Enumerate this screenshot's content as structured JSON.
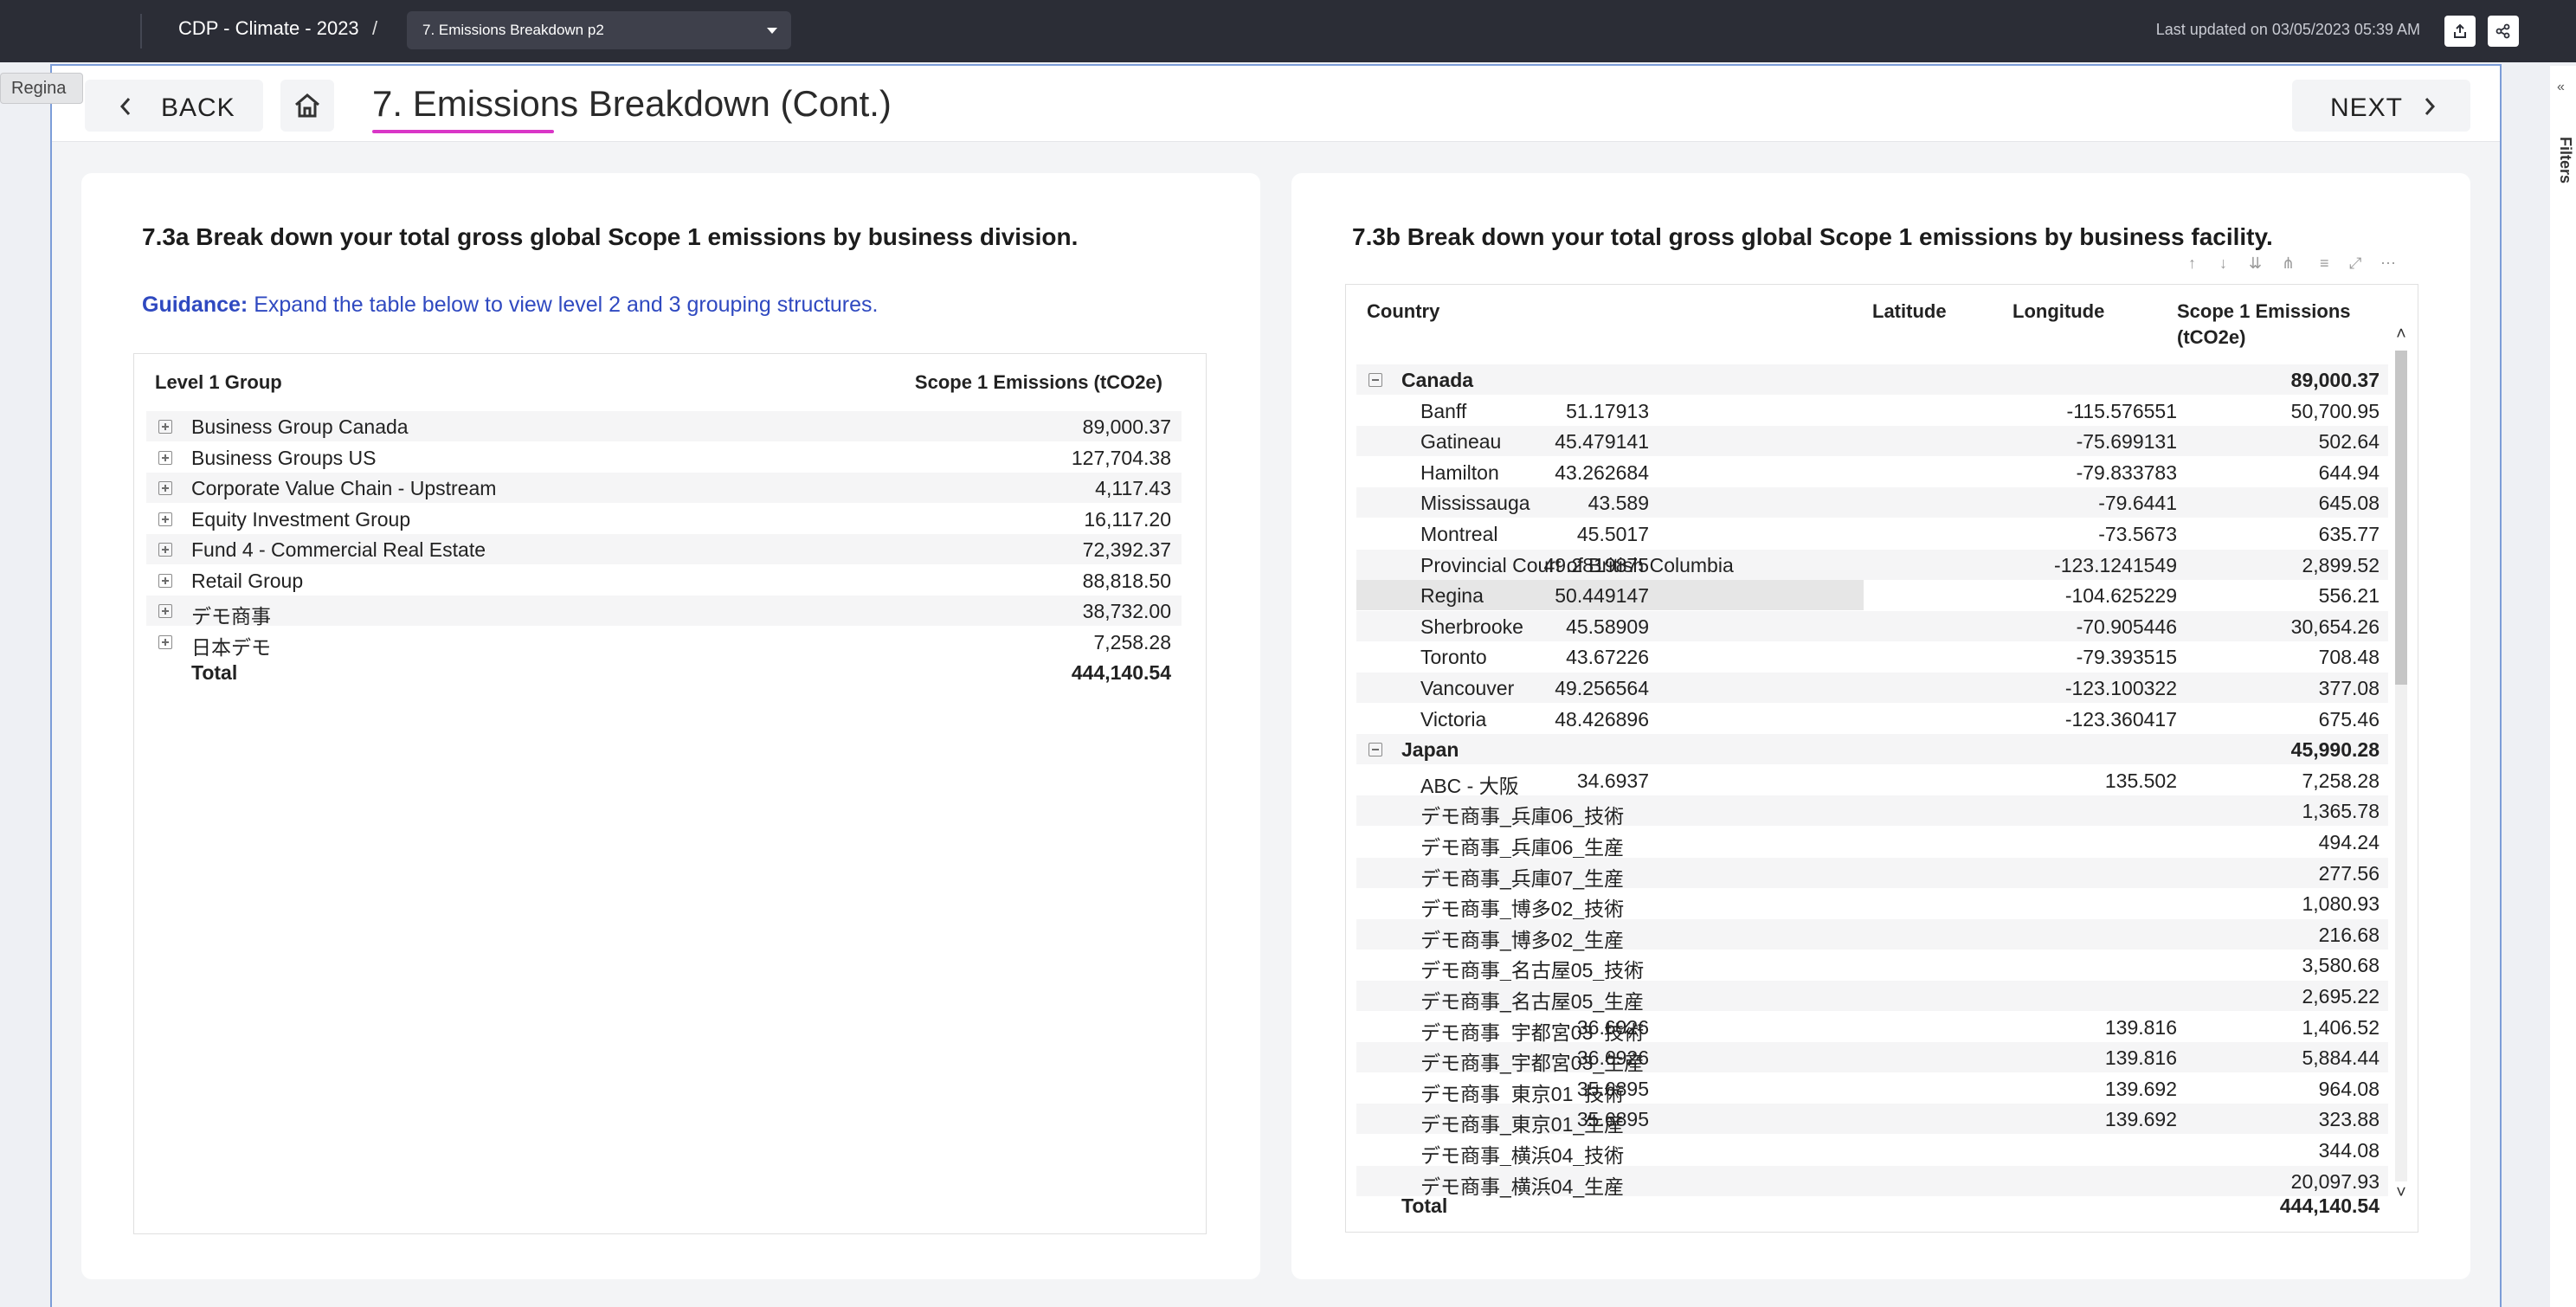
{
  "topbar": {
    "breadcrumb": "CDP - Climate - 2023",
    "slash": "/",
    "page_select": "7. Emissions Breakdown p2",
    "last_updated": "Last updated on 03/05/2023 05:39 AM"
  },
  "tooltip": "Regina",
  "nav": {
    "back_label": "BACK",
    "next_label": "NEXT",
    "title": "7. Emissions Breakdown (Cont.)"
  },
  "filters_label": "Filters",
  "left": {
    "heading": "7.3a Break down your total gross global Scope 1 emissions by business division.",
    "guidance_label": "Guidance:",
    "guidance_text": " Expand the table below to view level 2 and 3 grouping structures.",
    "columns": [
      "Level 1 Group",
      "Scope 1 Emissions (tCO2e)"
    ],
    "rows": [
      {
        "name": "Business Group Canada",
        "value": "89,000.37"
      },
      {
        "name": "Business Groups US",
        "value": "127,704.38"
      },
      {
        "name": "Corporate Value Chain - Upstream",
        "value": "4,117.43"
      },
      {
        "name": "Equity Investment Group",
        "value": "16,117.20"
      },
      {
        "name": "Fund 4 - Commercial Real Estate",
        "value": "72,392.37"
      },
      {
        "name": "Retail Group",
        "value": "88,818.50"
      },
      {
        "name": "デモ商事",
        "value": "38,732.00"
      },
      {
        "name": "日本デモ",
        "value": "7,258.28"
      }
    ],
    "total": {
      "name": "Total",
      "value": "444,140.54"
    }
  },
  "right": {
    "heading": "7.3b Break down your total gross global Scope 1 emissions by business facility.",
    "columns": [
      "Country",
      "Latitude",
      "Longitude",
      "Scope 1 Emissions",
      "(tCO2e)"
    ],
    "rows": [
      {
        "type": "group",
        "c0": "Canada",
        "c1": "",
        "c2": "",
        "c3": "89,000.37"
      },
      {
        "type": "row",
        "c0": "Banff",
        "c1": "51.17913",
        "c2": "-115.576551",
        "c3": "50,700.95"
      },
      {
        "type": "row",
        "c0": "Gatineau",
        "c1": "45.479141",
        "c2": "-75.699131",
        "c3": "502.64"
      },
      {
        "type": "row",
        "c0": "Hamilton",
        "c1": "43.262684",
        "c2": "-79.833783",
        "c3": "644.94"
      },
      {
        "type": "row",
        "c0": "Mississauga",
        "c1": "43.589",
        "c2": "-79.6441",
        "c3": "645.08"
      },
      {
        "type": "row",
        "c0": "Montreal",
        "c1": "45.5017",
        "c2": "-73.5673",
        "c3": "635.77"
      },
      {
        "type": "row",
        "c0": "Provincial Court of British Columbia",
        "c1": "49.2819875",
        "c2": "-123.1241549",
        "c3": "2,899.52"
      },
      {
        "type": "row",
        "c0": "Regina",
        "c1": "50.449147",
        "c2": "-104.625229",
        "c3": "556.21"
      },
      {
        "type": "row",
        "c0": "Sherbrooke",
        "c1": "45.58909",
        "c2": "-70.905446",
        "c3": "30,654.26"
      },
      {
        "type": "row",
        "c0": "Toronto",
        "c1": "43.67226",
        "c2": "-79.393515",
        "c3": "708.48"
      },
      {
        "type": "row",
        "c0": "Vancouver",
        "c1": "49.256564",
        "c2": "-123.100322",
        "c3": "377.08"
      },
      {
        "type": "row",
        "c0": "Victoria",
        "c1": "48.426896",
        "c2": "-123.360417",
        "c3": "675.46"
      },
      {
        "type": "group",
        "c0": "Japan",
        "c1": "",
        "c2": "",
        "c3": "45,990.28"
      },
      {
        "type": "row",
        "c0": "ABC - 大阪",
        "c1": "34.6937",
        "c2": "135.502",
        "c3": "7,258.28"
      },
      {
        "type": "row",
        "c0": "デモ商事_兵庫06_技術",
        "c1": "",
        "c2": "",
        "c3": "1,365.78"
      },
      {
        "type": "row",
        "c0": "デモ商事_兵庫06_生産",
        "c1": "",
        "c2": "",
        "c3": "494.24"
      },
      {
        "type": "row",
        "c0": "デモ商事_兵庫07_生産",
        "c1": "",
        "c2": "",
        "c3": "277.56"
      },
      {
        "type": "row",
        "c0": "デモ商事_博多02_技術",
        "c1": "",
        "c2": "",
        "c3": "1,080.93"
      },
      {
        "type": "row",
        "c0": "デモ商事_博多02_生産",
        "c1": "",
        "c2": "",
        "c3": "216.68"
      },
      {
        "type": "row",
        "c0": "デモ商事_名古屋05_技術",
        "c1": "",
        "c2": "",
        "c3": "3,580.68"
      },
      {
        "type": "row",
        "c0": "デモ商事_名古屋05_生産",
        "c1": "",
        "c2": "",
        "c3": "2,695.22"
      },
      {
        "type": "row",
        "c0": "デモ商事_宇都宮03_技術",
        "c1": "36.6926",
        "c2": "139.816",
        "c3": "1,406.52"
      },
      {
        "type": "row",
        "c0": "デモ商事_宇都宮03_生産",
        "c1": "36.6926",
        "c2": "139.816",
        "c3": "5,884.44"
      },
      {
        "type": "row",
        "c0": "デモ商事_東京01_技術",
        "c1": "35.6895",
        "c2": "139.692",
        "c3": "964.08"
      },
      {
        "type": "row",
        "c0": "デモ商事_東京01_生産",
        "c1": "35.6895",
        "c2": "139.692",
        "c3": "323.88"
      },
      {
        "type": "row",
        "c0": "デモ商事_横浜04_技術",
        "c1": "",
        "c2": "",
        "c3": "344.08"
      },
      {
        "type": "row",
        "c0": "デモ商事_横浜04_生産",
        "c1": "",
        "c2": "",
        "c3": "20,097.93"
      }
    ],
    "total": {
      "c0": "Total",
      "c3": "444,140.54"
    }
  }
}
